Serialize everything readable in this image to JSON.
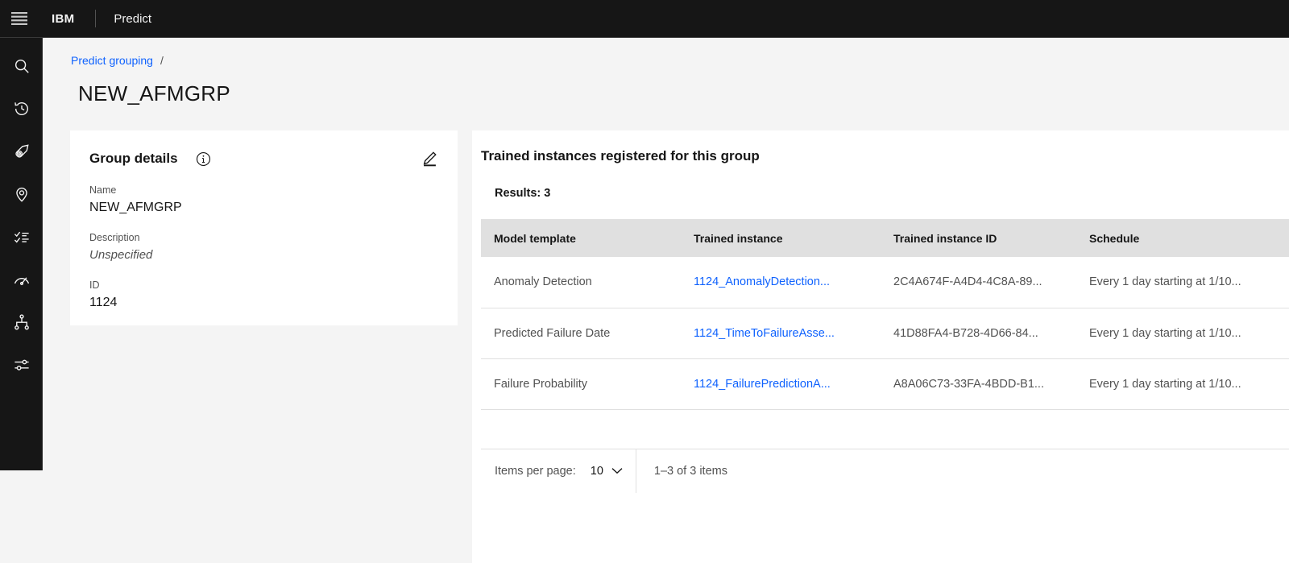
{
  "header": {
    "menu_icon": "hamburger-menu-icon",
    "brand": "IBM",
    "app_name": "Predict"
  },
  "sidebar": {
    "items": [
      {
        "icon": "search-icon",
        "name": "search"
      },
      {
        "icon": "history-icon",
        "name": "recently-viewed"
      },
      {
        "icon": "asset-tag-icon",
        "name": "assets"
      },
      {
        "icon": "location-pin-icon",
        "name": "locations"
      },
      {
        "icon": "task-list-icon",
        "name": "work-orders"
      },
      {
        "icon": "gauge-icon",
        "name": "meters"
      },
      {
        "icon": "hierarchy-icon",
        "name": "groupings"
      },
      {
        "icon": "sliders-icon",
        "name": "settings"
      }
    ]
  },
  "breadcrumb": {
    "link": "Predict grouping",
    "separator": "/"
  },
  "page": {
    "title": "NEW_AFMGRP"
  },
  "details_card": {
    "title": "Group details",
    "info_icon": "information-icon",
    "edit_icon": "edit-pencil-icon",
    "fields": [
      {
        "label": "Name",
        "value": "NEW_AFMGRP",
        "italic": false
      },
      {
        "label": "Description",
        "value": "Unspecified",
        "italic": true
      },
      {
        "label": "ID",
        "value": "1124",
        "italic": false
      }
    ]
  },
  "table_panel": {
    "title": "Trained instances registered for this group",
    "results_text": "Results: 3",
    "columns": [
      "Model template",
      "Trained instance",
      "Trained instance ID",
      "Schedule"
    ],
    "rows": [
      {
        "model_template": "Anomaly Detection",
        "trained_instance": "1124_AnomalyDetection...",
        "trained_instance_id": "2C4A674F-A4D4-4C8A-89...",
        "schedule": "Every 1 day starting at 1/10..."
      },
      {
        "model_template": "Predicted Failure Date",
        "trained_instance": "1124_TimeToFailureAsse...",
        "trained_instance_id": "41D88FA4-B728-4D66-84...",
        "schedule": "Every 1 day starting at 1/10..."
      },
      {
        "model_template": "Failure Probability",
        "trained_instance": "1124_FailurePredictionA...",
        "trained_instance_id": "A8A06C73-33FA-4BDD-B1...",
        "schedule": "Every 1 day starting at 1/10..."
      }
    ],
    "pagination": {
      "items_per_page_label": "Items per page:",
      "items_per_page_value": "10",
      "chevron_icon": "chevron-down-icon",
      "range_text": "1–3 of 3 items"
    }
  },
  "colors": {
    "header_bg": "#161616",
    "page_bg": "#f4f4f4",
    "card_bg": "#ffffff",
    "link_blue": "#0f62fe",
    "table_header_bg": "#e0e0e0",
    "text_primary": "#161616",
    "text_secondary": "#525252"
  }
}
